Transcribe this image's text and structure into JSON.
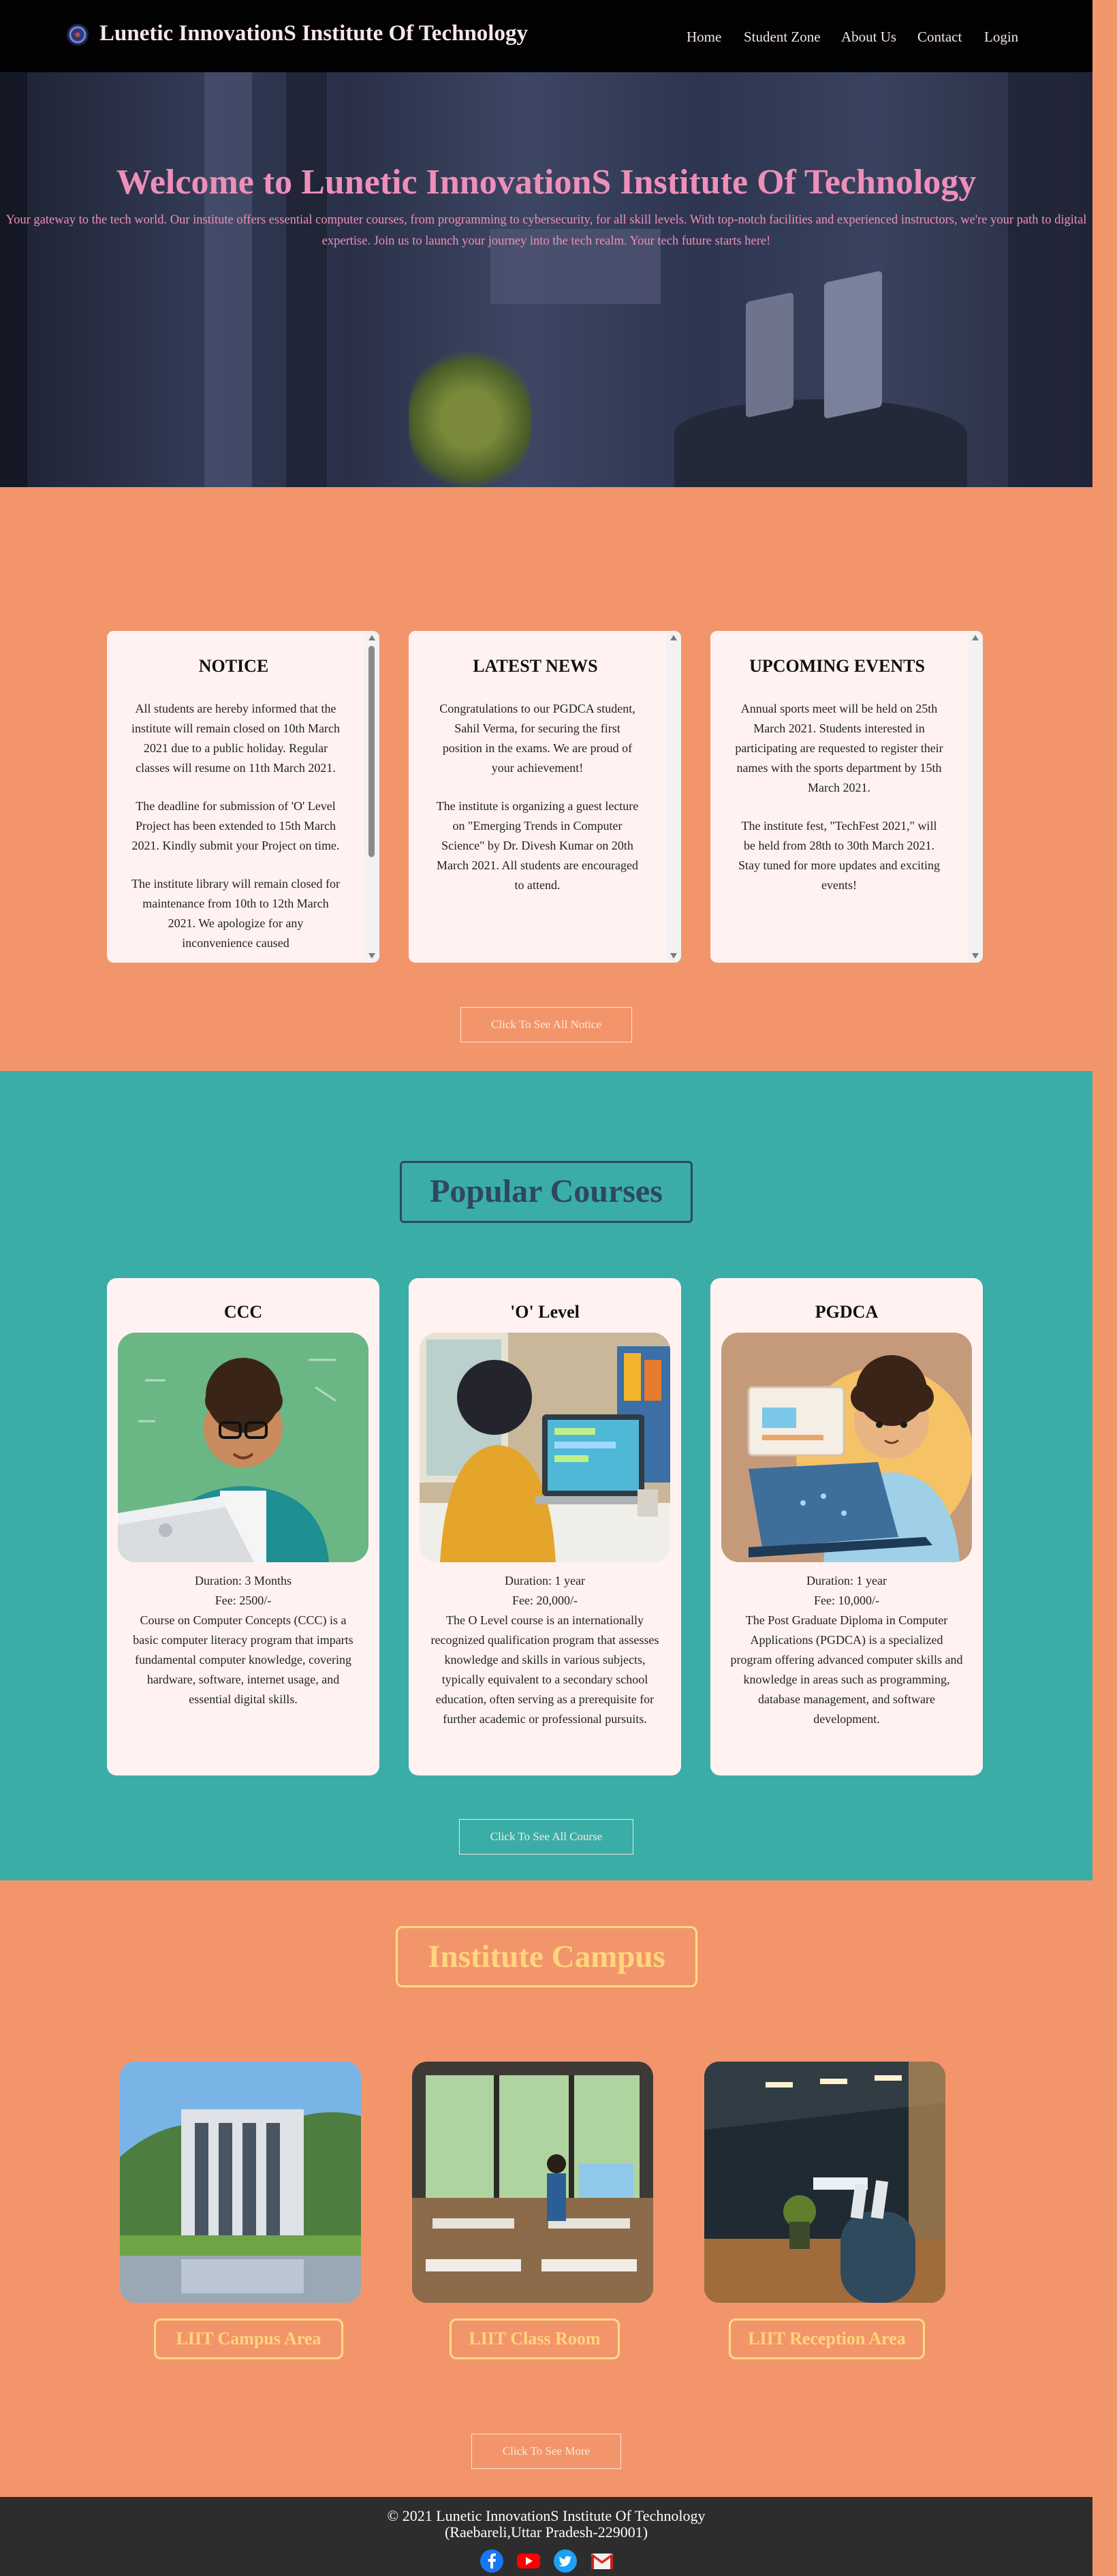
{
  "nav": {
    "brand": "Lunetic InnovationS Institute Of Technology",
    "links": [
      "Home",
      "Student Zone",
      "About Us",
      "Contact",
      "Login"
    ]
  },
  "hero": {
    "title": "Welcome to Lunetic InnovationS Institute Of Technology",
    "text": "Your gateway to the tech world. Our institute offers essential computer courses, from programming to cybersecurity, for all skill levels. With top-notch facilities and experienced instructors, we're your path to digital expertise. Join us to launch your journey into the tech realm. Your tech future starts here!"
  },
  "notices": {
    "boxes": [
      {
        "title": "NOTICE",
        "items": [
          "All students are hereby informed that the institute will remain closed on 10th March 2021 due to a public holiday. Regular classes will resume on 11th March 2021.",
          "The deadline for submission of 'O' Level Project has been extended to 15th March 2021. Kindly submit your Project on time.",
          "The institute library will remain closed for maintenance from 10th to 12th March 2021. We apologize for any inconvenience caused"
        ]
      },
      {
        "title": "LATEST NEWS",
        "items": [
          "Congratulations to our PGDCA student, Sahil Verma, for securing the first position in the exams. We are proud of your achievement!",
          "The institute is organizing a guest lecture on \"Emerging Trends in Computer Science\" by Dr. Divesh Kumar on 20th March 2021. All students are encouraged to attend."
        ]
      },
      {
        "title": "UPCOMING EVENTS",
        "items": [
          "Annual sports meet will be held on 25th March 2021. Students interested in participating are requested to register their names with the sports department by 15th March 2021.",
          "The institute fest, \"TechFest 2021,\" will be held from 28th to 30th March 2021. Stay tuned for more updates and exciting events!"
        ]
      }
    ],
    "button": "Click To See All Notice"
  },
  "courses": {
    "title": "Popular Courses",
    "cards": [
      {
        "name": "CCC",
        "duration": "Duration: 3 Months",
        "fee": "Fee: 2500/-",
        "description": "Course on Computer Concepts (CCC) is a basic computer literacy program that imparts fundamental computer knowledge, covering hardware, software, internet usage, and essential digital skills."
      },
      {
        "name": "'O' Level",
        "duration": "Duration: 1 year",
        "fee": "Fee: 20,000/-",
        "description": "The O Level course is an internationally recognized qualification program that assesses knowledge and skills in various subjects, typically equivalent to a secondary school education, often serving as a prerequisite for further academic or professional pursuits."
      },
      {
        "name": "PGDCA",
        "duration": "Duration: 1 year",
        "fee": "Fee: 10,000/-",
        "description": "The Post Graduate Diploma in Computer Applications (PGDCA) is a specialized program offering advanced computer skills and knowledge in areas such as programming, database management, and software development."
      }
    ],
    "button": "Click To See All Course"
  },
  "campus": {
    "title": "Institute Campus",
    "photos": [
      {
        "label": "LIIT Campus Area"
      },
      {
        "label": "LIIT Class Room"
      },
      {
        "label": "LIIT Reception Area"
      }
    ],
    "button": "Click To See More"
  },
  "footer": {
    "copyright": "© 2021 Lunetic InnovationS Institute Of Technology",
    "address": "(Raebareli,Uttar Pradesh-229001)",
    "social": [
      "facebook-icon",
      "youtube-icon",
      "twitter-icon",
      "gmail-icon"
    ]
  },
  "colors": {
    "nav_bg": "#020202",
    "accent_pink": "#ee8fb9",
    "salmon": "#f3956a",
    "teal": "#3aada7",
    "card_bg": "#fff2f1",
    "gold": "#ffd67f",
    "navy": "#2f4766",
    "footer_bg": "#2d2d2d"
  }
}
